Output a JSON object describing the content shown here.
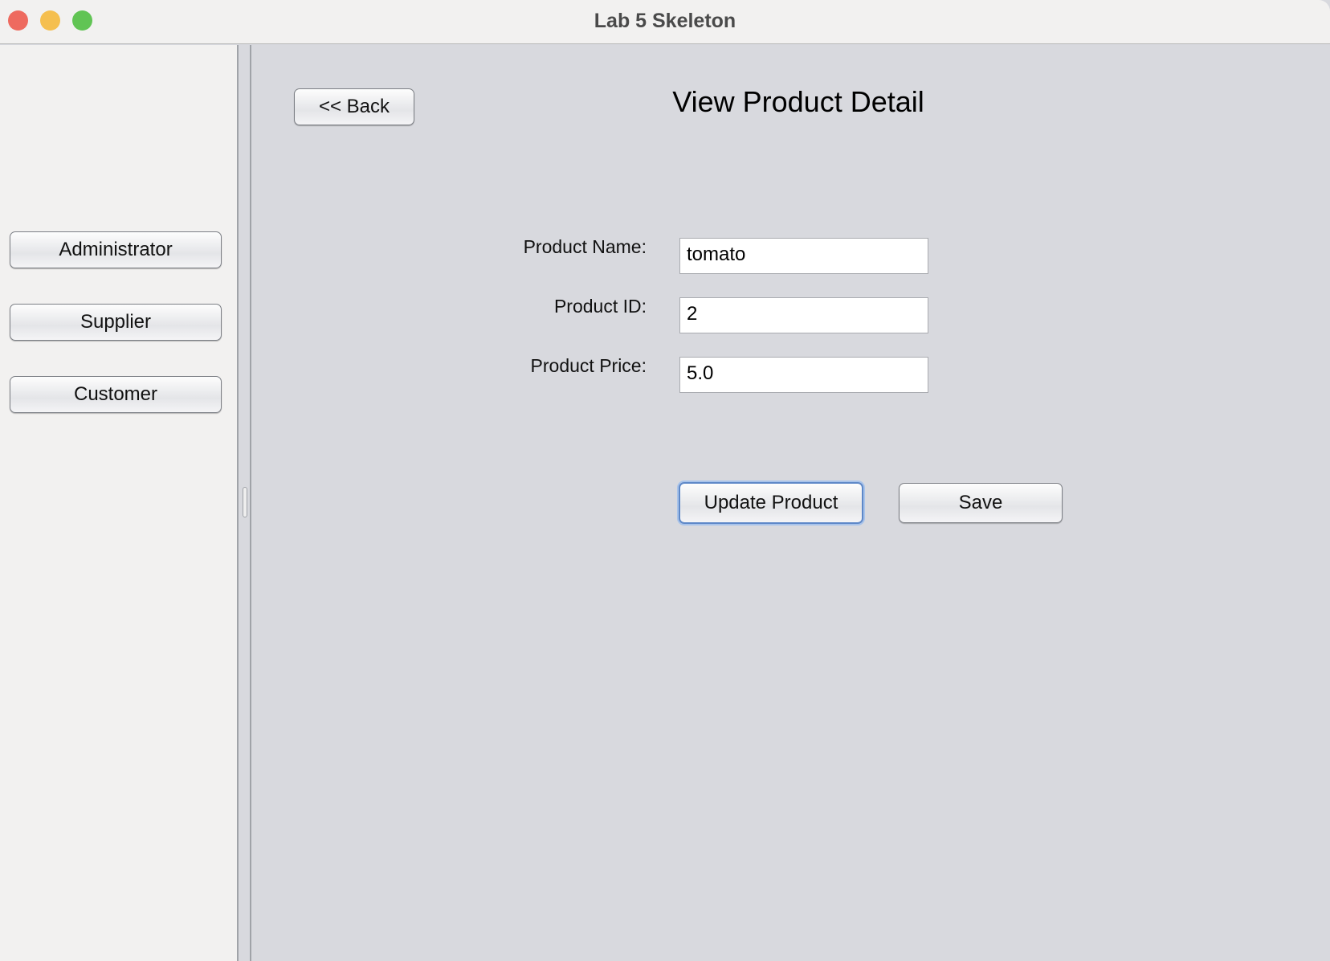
{
  "window": {
    "title": "Lab 5 Skeleton",
    "traffic_lights": {
      "close": "#ee6a5f",
      "minimize": "#f5bf4f",
      "zoom": "#61c454"
    }
  },
  "sidebar": {
    "items": [
      {
        "label": "Administrator"
      },
      {
        "label": "Supplier"
      },
      {
        "label": "Customer"
      }
    ]
  },
  "main": {
    "back_label": "<< Back",
    "heading": "View Product Detail",
    "fields": [
      {
        "label": "Product Name:",
        "value": "tomato"
      },
      {
        "label": "Product ID:",
        "value": "2"
      },
      {
        "label": "Product Price:",
        "value": "5.0"
      }
    ],
    "update_label": "Update Product",
    "save_label": "Save"
  }
}
